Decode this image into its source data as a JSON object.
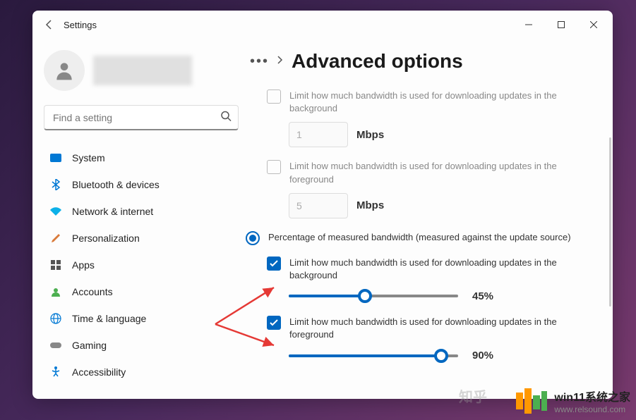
{
  "app": {
    "title": "Settings"
  },
  "search": {
    "placeholder": "Find a setting"
  },
  "nav": {
    "items": [
      {
        "label": "System",
        "icon": "🖥️"
      },
      {
        "label": "Bluetooth & devices",
        "icon": "bt"
      },
      {
        "label": "Network & internet",
        "icon": "📶"
      },
      {
        "label": "Personalization",
        "icon": "🖌️"
      },
      {
        "label": "Apps",
        "icon": "▦"
      },
      {
        "label": "Accounts",
        "icon": "👤"
      },
      {
        "label": "Time & language",
        "icon": "🌐"
      },
      {
        "label": "Gaming",
        "icon": "🎮"
      },
      {
        "label": "Accessibility",
        "icon": "acc"
      }
    ]
  },
  "breadcrumb": {
    "title": "Advanced options"
  },
  "options": {
    "abs_bg": {
      "label": "Limit how much bandwidth is used for downloading updates in the background",
      "checked": false,
      "value": "1",
      "unit": "Mbps"
    },
    "abs_fg": {
      "label": "Limit how much bandwidth is used for downloading updates in the foreground",
      "checked": false,
      "value": "5",
      "unit": "Mbps"
    },
    "radio_pct": {
      "label": "Percentage of measured bandwidth (measured against the update source)",
      "selected": true
    },
    "pct_bg": {
      "label": "Limit how much bandwidth is used for downloading updates in the background",
      "checked": true,
      "value": 45,
      "display": "45%"
    },
    "pct_fg": {
      "label": "Limit how much bandwidth is used for downloading updates in the foreground",
      "checked": true,
      "value": 90,
      "display": "90%"
    }
  },
  "watermark": {
    "title": "win11系统之家",
    "url": "www.relsound.com",
    "zhihu": "知乎"
  }
}
